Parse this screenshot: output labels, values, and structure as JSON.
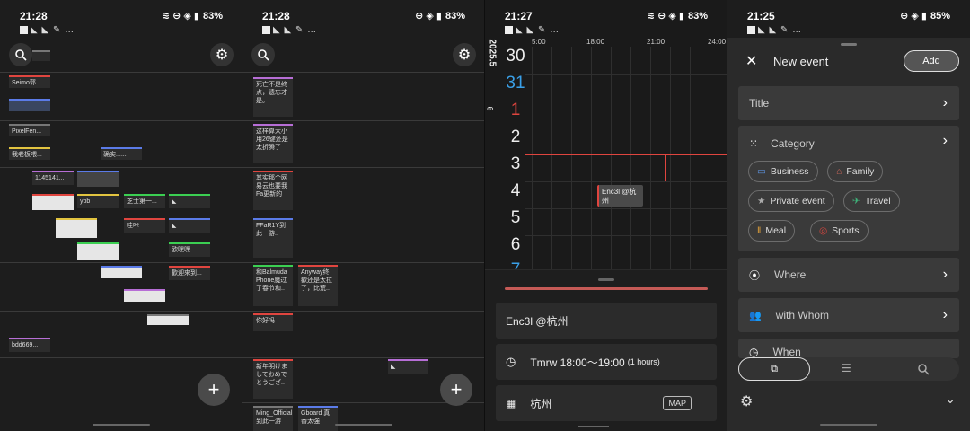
{
  "status_bars": [
    {
      "time": "21:28",
      "battery": "83%"
    },
    {
      "time": "21:28",
      "battery": "83%"
    },
    {
      "time": "21:27",
      "battery": "83%"
    },
    {
      "time": "21:25",
      "battery": "85%"
    }
  ],
  "panel1": {
    "events": [
      "Seimo郭...",
      "PixelFen...",
      "我老板喂...",
      "确实......",
      "1145141...",
      "ybb",
      "芝士第一...",
      "哇咔",
      "欧嘿嘿...",
      "歡迎來到...",
      "bdd669..."
    ]
  },
  "panel2": {
    "events": [
      "死亡不是终点，遗忘才是。",
      "这样算大小用26键还是太折腾了",
      "其实那个网易云也要我Fa更新的",
      "FFaR1Y到此一游..",
      "和Balmuda Phone魔过了春节和..",
      "Anyway终歡还是太拉了，比荒..",
      "你好吗",
      "新年明けましておめでとうござ..",
      "Ming_Official到此一游",
      "Gboard 真香太強"
    ]
  },
  "panel3": {
    "year_month": "2025.5",
    "dates": [
      "30",
      "31",
      "1",
      "2",
      "3",
      "4",
      "5",
      "6",
      "7"
    ],
    "week_marker": "6",
    "hours": [
      "5:00",
      "18:00",
      "21:00",
      "24:00"
    ],
    "event_chip": "Enc3l @杭州",
    "title": "Enc3l @杭州",
    "time": "Tmrw 18:00〜19:00",
    "duration": "(1 hours)",
    "location": "杭州",
    "map_label": "MAP"
  },
  "panel4": {
    "header": "New event",
    "add_label": "Add",
    "title_label": "Title",
    "category_label": "Category",
    "chips": [
      "Business",
      "Family",
      "Private event",
      "Travel",
      "Meal",
      "Sports"
    ],
    "where_label": "Where",
    "whom_label": "with Whom",
    "when_label": "When"
  },
  "colors": {
    "accent_red": "#e0453f",
    "accent_blue": "#3aa0e8",
    "bg": "#1b1b1b"
  }
}
